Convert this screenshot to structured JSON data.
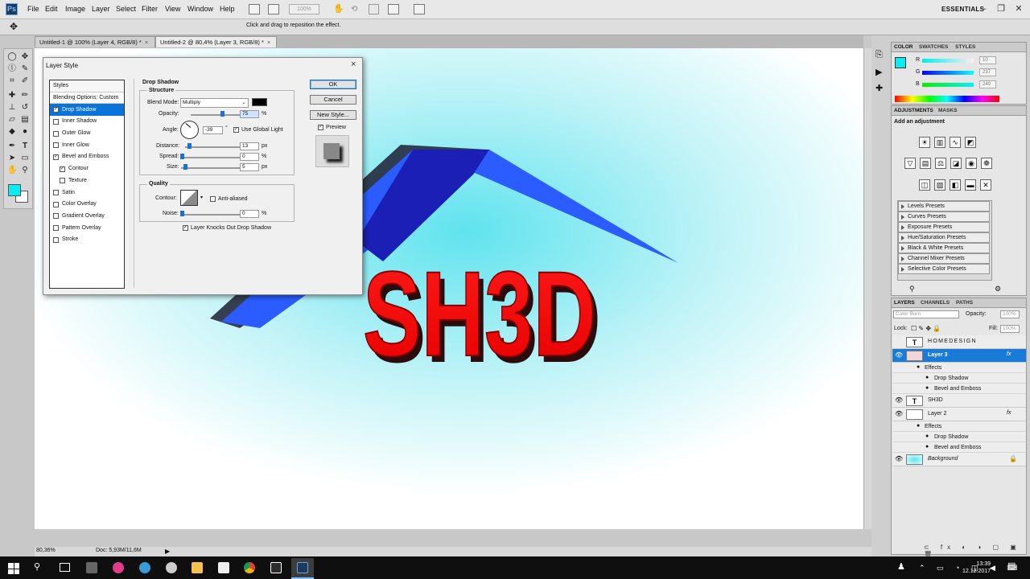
{
  "app": {
    "name": "Ps",
    "workspace": "ESSENTIALS",
    "zoom_box": "100%"
  },
  "menu": [
    "File",
    "Edit",
    "Image",
    "Layer",
    "Select",
    "Filter",
    "View",
    "Window",
    "Help"
  ],
  "options_bar": {
    "hint": "Click and drag to reposition the effect."
  },
  "tabs": [
    {
      "label": "Untitled-1 @ 100% (Layer 4, RGB/8) *",
      "close": "×"
    },
    {
      "label": "Untitled-2 @ 80,4% (Layer 3, RGB/8) *",
      "close": "×"
    }
  ],
  "canvas": {
    "text": "SH3D"
  },
  "status": {
    "zoom": "80,36%",
    "doc": "Doc: 5,93M/11,6M"
  },
  "taskbar": {
    "time": "13:39",
    "date": "12.12.2017"
  },
  "dialog": {
    "title": "Layer Style",
    "close": "×",
    "styles_header": "Styles",
    "styles": [
      {
        "label": "Blending Options: Custom",
        "checked": null
      },
      {
        "label": "Drop Shadow",
        "checked": true,
        "selected": true
      },
      {
        "label": "Inner Shadow",
        "checked": false
      },
      {
        "label": "Outer Glow",
        "checked": false
      },
      {
        "label": "Inner Glow",
        "checked": false
      },
      {
        "label": "Bevel and Emboss",
        "checked": true
      },
      {
        "label": "Contour",
        "checked": true,
        "indent": true
      },
      {
        "label": "Texture",
        "checked": false,
        "indent": true
      },
      {
        "label": "Satin",
        "checked": false
      },
      {
        "label": "Color Overlay",
        "checked": false
      },
      {
        "label": "Gradient Overlay",
        "checked": false
      },
      {
        "label": "Pattern Overlay",
        "checked": false
      },
      {
        "label": "Stroke",
        "checked": false
      }
    ],
    "section": "Drop Shadow",
    "structure": "Structure",
    "blend_mode_label": "Blend Mode:",
    "blend_mode": "Multiply",
    "opacity_label": "Opacity:",
    "opacity": "75",
    "opacity_unit": "%",
    "angle_label": "Angle:",
    "angle": "-39",
    "angle_unit": "°",
    "global_light": "Use Global Light",
    "distance_label": "Distance:",
    "distance": "13",
    "spread_label": "Spread:",
    "spread": "0",
    "size_label": "Size:",
    "size": "5",
    "px": "px",
    "pct": "%",
    "quality": "Quality",
    "contour_label": "Contour:",
    "anti_aliased": "Anti-aliased",
    "noise_label": "Noise:",
    "noise": "0",
    "knockout": "Layer Knocks Out Drop Shadow",
    "ok": "OK",
    "cancel": "Cancel",
    "new_style": "New Style...",
    "preview": "Preview"
  },
  "color_panel": {
    "tabs": [
      "COLOR",
      "SWATCHES",
      "STYLES"
    ],
    "r_label": "R",
    "r": "10",
    "g_label": "G",
    "g": "237",
    "b_label": "B",
    "b": "240",
    "fg_color": "#0aedf0"
  },
  "adjustments_panel": {
    "tabs": [
      "ADJUSTMENTS",
      "MASKS"
    ],
    "heading": "Add an adjustment",
    "presets": [
      "Levels Presets",
      "Curves Presets",
      "Exposure Presets",
      "Hue/Saturation Presets",
      "Black & White Presets",
      "Channel Mixer Presets",
      "Selective Color Presets"
    ]
  },
  "layers_panel": {
    "tabs": [
      "LAYERS",
      "CHANNELS",
      "PATHS"
    ],
    "blend": "Color Burn",
    "opacity_label": "Opacity:",
    "opacity": "100%",
    "lock_label": "Lock:",
    "fill_label": "Fill:",
    "fill": "100%",
    "layers": [
      {
        "name": "HOMEDESIGN",
        "type": "text"
      },
      {
        "name": "Layer 3",
        "type": "image",
        "selected": true,
        "fx": true
      },
      {
        "name": "Effects",
        "type": "effects"
      },
      {
        "name": "Drop Shadow",
        "type": "effect"
      },
      {
        "name": "Bevel and Emboss",
        "type": "effect"
      },
      {
        "name": "SH3D",
        "type": "text"
      },
      {
        "name": "Layer 2",
        "type": "image",
        "fx": true
      },
      {
        "name": "Effects",
        "type": "effects"
      },
      {
        "name": "Drop Shadow",
        "type": "effect"
      },
      {
        "name": "Bevel and Emboss",
        "type": "effect"
      },
      {
        "name": "Background",
        "type": "background"
      }
    ],
    "fx_label": "fx",
    "text_thumb": "T"
  },
  "colors": {
    "accent": "#1a7bd6",
    "canvas_cyan": "#5fe3ee",
    "logo_red": "#ff0a0a",
    "roof_blue": "#1c33c8"
  }
}
